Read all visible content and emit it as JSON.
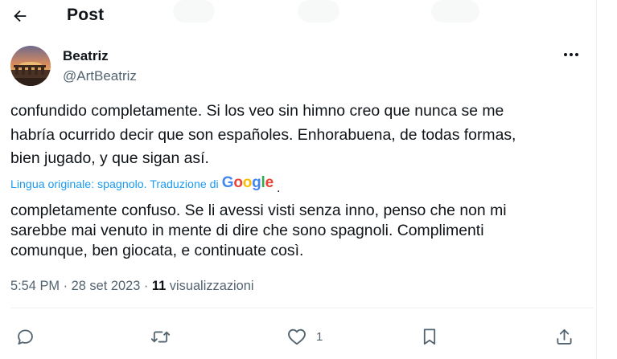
{
  "header": {
    "back_icon": "arrow-left-icon",
    "title": "Post"
  },
  "author": {
    "display_name": "Beatriz",
    "handle": "@ArtBeatriz",
    "avatar": "landscape-sunset-avatar"
  },
  "tweet": {
    "lines": [
      "confundido completamente. Si los veo sin himno creo que nunca se me",
      "habría ocurrido decir que son españoles. Enhorabuena, de todas formas,",
      "bien jugado, y que sigan así."
    ]
  },
  "translation": {
    "label": "Lingua originale: spagnolo. Traduzione di",
    "provider_letters": [
      {
        "ch": "G",
        "color": "#4285f4"
      },
      {
        "ch": "o",
        "color": "#ea4335"
      },
      {
        "ch": "o",
        "color": "#fbbc05"
      },
      {
        "ch": "g",
        "color": "#4285f4"
      },
      {
        "ch": "l",
        "color": "#34a853"
      },
      {
        "ch": "e",
        "color": "#ea4335"
      }
    ],
    "lines": [
      "completamente confuso. Se li avessi visti senza inno, penso che non mi",
      "sarebbe mai venuto in mente di dire che sono spagnoli. Complimenti",
      "comunque, ben giocata, e continuate così."
    ]
  },
  "meta": {
    "time": "5:54 PM",
    "date": "28 set 2023",
    "separator": "·",
    "views_count": "11",
    "views_label": "visualizzazioni"
  },
  "actions": [
    {
      "name": "reply",
      "icon": "reply-icon",
      "count": ""
    },
    {
      "name": "repost",
      "icon": "repost-icon",
      "count": ""
    },
    {
      "name": "like",
      "icon": "heart-icon",
      "count": "1"
    },
    {
      "name": "bookmark",
      "icon": "bookmark-icon",
      "count": ""
    },
    {
      "name": "share",
      "icon": "share-icon",
      "count": ""
    }
  ],
  "colors": {
    "text": "#0f1419",
    "secondary": "#536471",
    "link": "#1d9bf0"
  }
}
